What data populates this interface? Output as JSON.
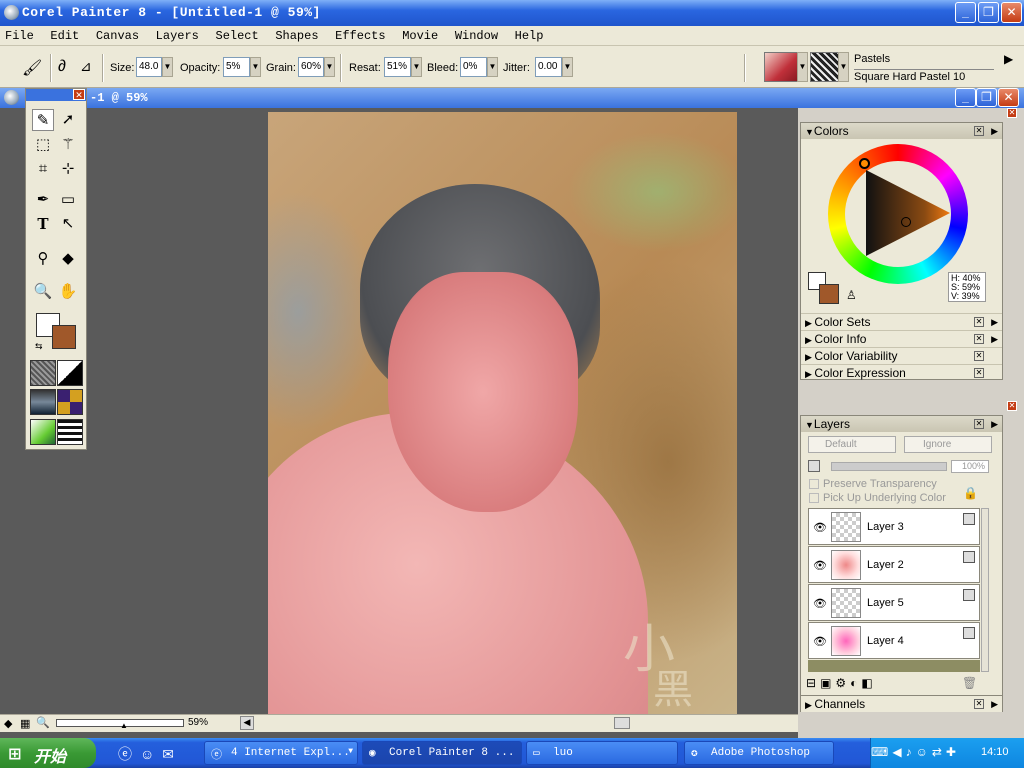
{
  "app": {
    "title": "Corel Painter 8 - [Untitled-1 @ 59%]",
    "doc_title": "-1 @ 59%"
  },
  "menu": [
    "File",
    "Edit",
    "Canvas",
    "Layers",
    "Select",
    "Shapes",
    "Effects",
    "Movie",
    "Window",
    "Help"
  ],
  "property_bar": {
    "size_label": "Size:",
    "size_value": "48.0",
    "opacity_label": "Opacity:",
    "opacity_value": "5%",
    "grain_label": "Grain:",
    "grain_value": "60%",
    "resat_label": "Resat:",
    "resat_value": "51%",
    "bleed_label": "Bleed:",
    "bleed_value": "0%",
    "jitter_label": "Jitter:",
    "jitter_value": "0.00",
    "brush_category": "Pastels",
    "brush_variant": "Square Hard Pastel 10"
  },
  "colors": {
    "main_color": "#a0582a",
    "additional_color": "#ffffff",
    "hue": "H: 40%",
    "sat": "S: 59%",
    "val": "V: 39%"
  },
  "panels": {
    "colors_title": "Colors",
    "collapsed": [
      "Color Sets",
      "Color Info",
      "Color Variability",
      "Color Expression"
    ],
    "layers_title": "Layers",
    "channels_title": "Channels"
  },
  "layers_panel": {
    "composite_method": "Default",
    "depth": "Ignore",
    "opacity": "100%",
    "preserve_transparency": "Preserve Transparency",
    "pick_up_underlying": "Pick Up Underlying Color",
    "layers": [
      "Layer 3",
      "Layer 2",
      "Layer 5",
      "Layer 4"
    ]
  },
  "status": {
    "zoom": "59%"
  },
  "watermark": [
    "小",
    "黑"
  ],
  "taskbar": {
    "start_label": "开始",
    "tasks": [
      "4 Internet Expl...",
      "Corel Painter 8 ...",
      "luo",
      "Adobe Photoshop"
    ],
    "clock": "14:10"
  }
}
